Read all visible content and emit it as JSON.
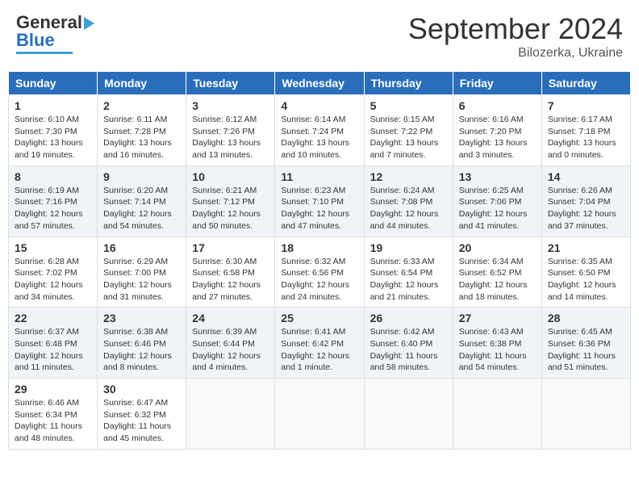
{
  "header": {
    "logo_general": "General",
    "logo_blue": "Blue",
    "month_title": "September 2024",
    "subtitle": "Bilozerka, Ukraine"
  },
  "days_of_week": [
    "Sunday",
    "Monday",
    "Tuesday",
    "Wednesday",
    "Thursday",
    "Friday",
    "Saturday"
  ],
  "weeks": [
    [
      {
        "day": "1",
        "sunrise": "6:10 AM",
        "sunset": "7:30 PM",
        "daylight": "13 hours and 19 minutes."
      },
      {
        "day": "2",
        "sunrise": "6:11 AM",
        "sunset": "7:28 PM",
        "daylight": "13 hours and 16 minutes."
      },
      {
        "day": "3",
        "sunrise": "6:12 AM",
        "sunset": "7:26 PM",
        "daylight": "13 hours and 13 minutes."
      },
      {
        "day": "4",
        "sunrise": "6:14 AM",
        "sunset": "7:24 PM",
        "daylight": "13 hours and 10 minutes."
      },
      {
        "day": "5",
        "sunrise": "6:15 AM",
        "sunset": "7:22 PM",
        "daylight": "13 hours and 7 minutes."
      },
      {
        "day": "6",
        "sunrise": "6:16 AM",
        "sunset": "7:20 PM",
        "daylight": "13 hours and 3 minutes."
      },
      {
        "day": "7",
        "sunrise": "6:17 AM",
        "sunset": "7:18 PM",
        "daylight": "13 hours and 0 minutes."
      }
    ],
    [
      {
        "day": "8",
        "sunrise": "6:19 AM",
        "sunset": "7:16 PM",
        "daylight": "12 hours and 57 minutes."
      },
      {
        "day": "9",
        "sunrise": "6:20 AM",
        "sunset": "7:14 PM",
        "daylight": "12 hours and 54 minutes."
      },
      {
        "day": "10",
        "sunrise": "6:21 AM",
        "sunset": "7:12 PM",
        "daylight": "12 hours and 50 minutes."
      },
      {
        "day": "11",
        "sunrise": "6:23 AM",
        "sunset": "7:10 PM",
        "daylight": "12 hours and 47 minutes."
      },
      {
        "day": "12",
        "sunrise": "6:24 AM",
        "sunset": "7:08 PM",
        "daylight": "12 hours and 44 minutes."
      },
      {
        "day": "13",
        "sunrise": "6:25 AM",
        "sunset": "7:06 PM",
        "daylight": "12 hours and 41 minutes."
      },
      {
        "day": "14",
        "sunrise": "6:26 AM",
        "sunset": "7:04 PM",
        "daylight": "12 hours and 37 minutes."
      }
    ],
    [
      {
        "day": "15",
        "sunrise": "6:28 AM",
        "sunset": "7:02 PM",
        "daylight": "12 hours and 34 minutes."
      },
      {
        "day": "16",
        "sunrise": "6:29 AM",
        "sunset": "7:00 PM",
        "daylight": "12 hours and 31 minutes."
      },
      {
        "day": "17",
        "sunrise": "6:30 AM",
        "sunset": "6:58 PM",
        "daylight": "12 hours and 27 minutes."
      },
      {
        "day": "18",
        "sunrise": "6:32 AM",
        "sunset": "6:56 PM",
        "daylight": "12 hours and 24 minutes."
      },
      {
        "day": "19",
        "sunrise": "6:33 AM",
        "sunset": "6:54 PM",
        "daylight": "12 hours and 21 minutes."
      },
      {
        "day": "20",
        "sunrise": "6:34 AM",
        "sunset": "6:52 PM",
        "daylight": "12 hours and 18 minutes."
      },
      {
        "day": "21",
        "sunrise": "6:35 AM",
        "sunset": "6:50 PM",
        "daylight": "12 hours and 14 minutes."
      }
    ],
    [
      {
        "day": "22",
        "sunrise": "6:37 AM",
        "sunset": "6:48 PM",
        "daylight": "12 hours and 11 minutes."
      },
      {
        "day": "23",
        "sunrise": "6:38 AM",
        "sunset": "6:46 PM",
        "daylight": "12 hours and 8 minutes."
      },
      {
        "day": "24",
        "sunrise": "6:39 AM",
        "sunset": "6:44 PM",
        "daylight": "12 hours and 4 minutes."
      },
      {
        "day": "25",
        "sunrise": "6:41 AM",
        "sunset": "6:42 PM",
        "daylight": "12 hours and 1 minute."
      },
      {
        "day": "26",
        "sunrise": "6:42 AM",
        "sunset": "6:40 PM",
        "daylight": "11 hours and 58 minutes."
      },
      {
        "day": "27",
        "sunrise": "6:43 AM",
        "sunset": "6:38 PM",
        "daylight": "11 hours and 54 minutes."
      },
      {
        "day": "28",
        "sunrise": "6:45 AM",
        "sunset": "6:36 PM",
        "daylight": "11 hours and 51 minutes."
      }
    ],
    [
      {
        "day": "29",
        "sunrise": "6:46 AM",
        "sunset": "6:34 PM",
        "daylight": "11 hours and 48 minutes."
      },
      {
        "day": "30",
        "sunrise": "6:47 AM",
        "sunset": "6:32 PM",
        "daylight": "11 hours and 45 minutes."
      },
      null,
      null,
      null,
      null,
      null
    ]
  ]
}
